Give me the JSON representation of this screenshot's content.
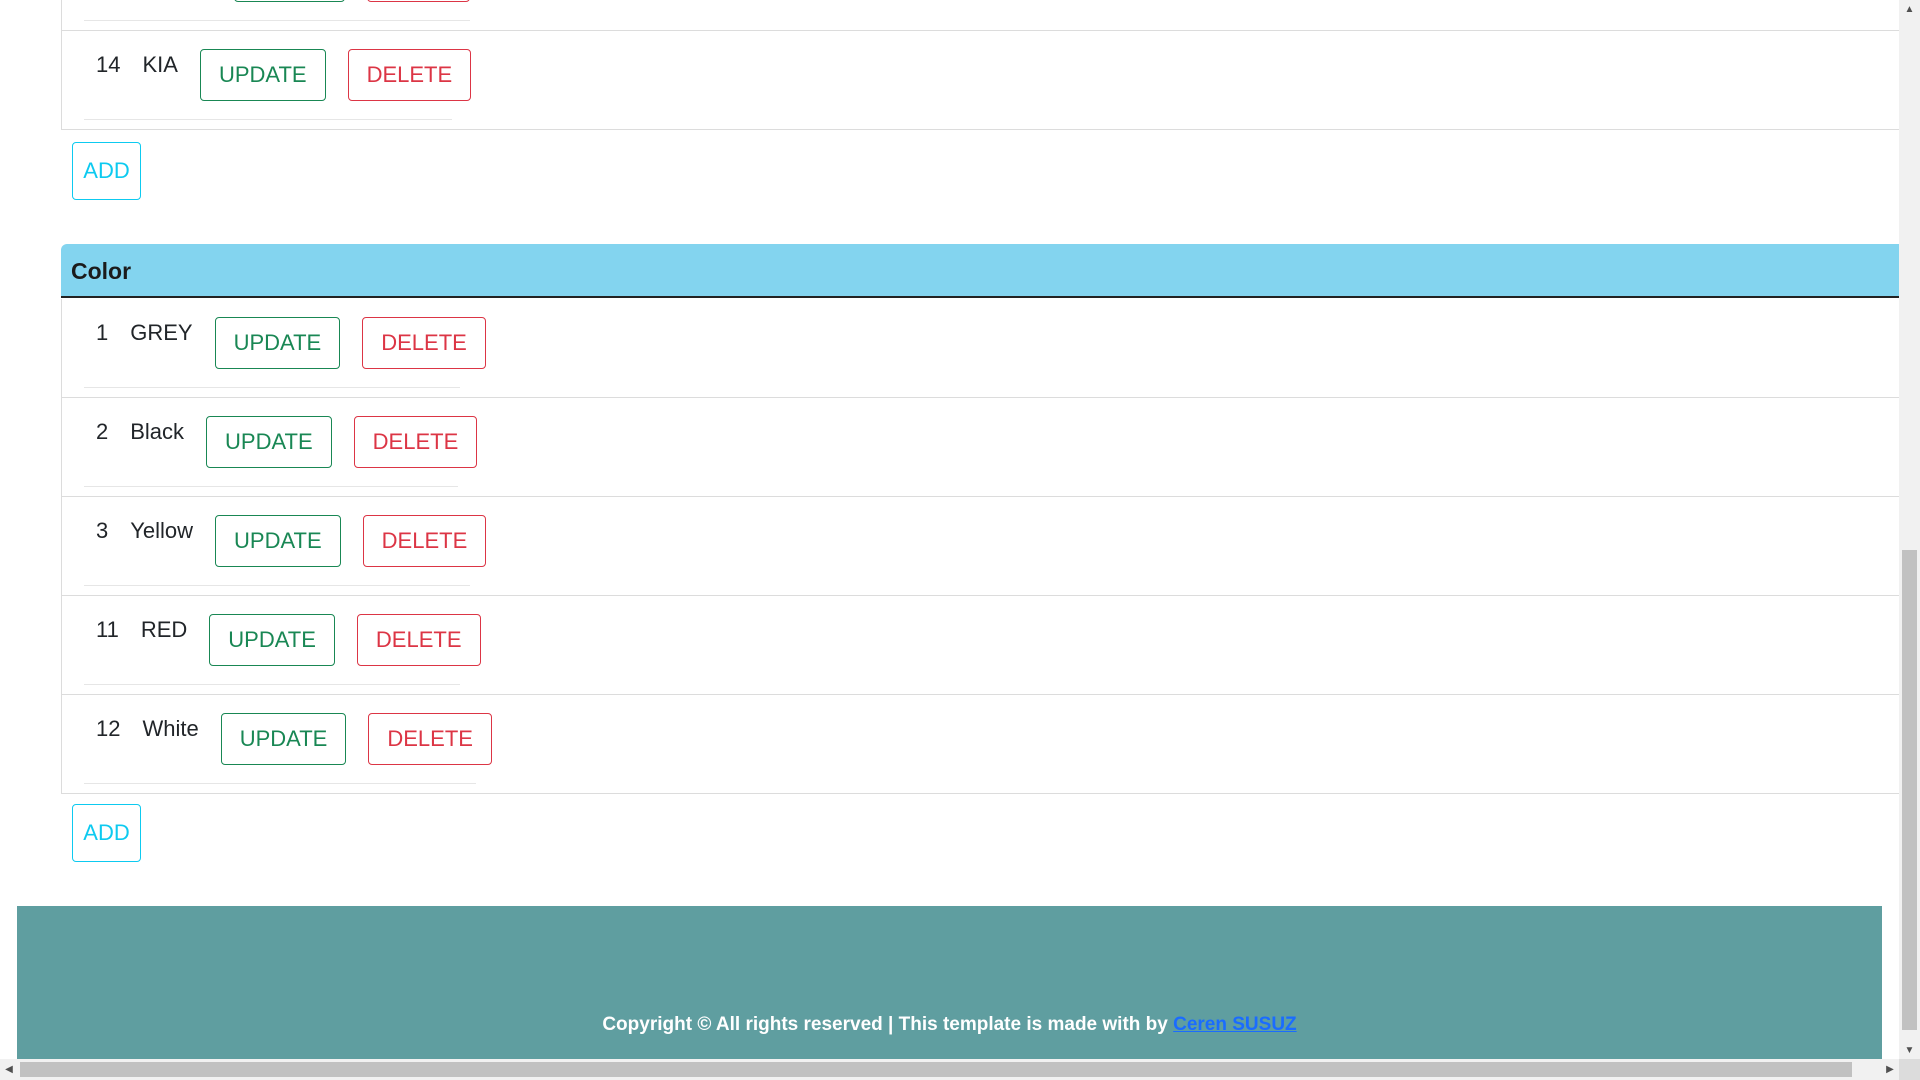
{
  "brand_section": {
    "rows": [
      {
        "id": "14",
        "name": "KIA",
        "update_label": "UPDATE",
        "delete_label": "DELETE"
      }
    ],
    "add_label": "ADD"
  },
  "color_section": {
    "title": "Color",
    "rows": [
      {
        "id": "1",
        "name": "GREY",
        "update_label": "UPDATE",
        "delete_label": "DELETE"
      },
      {
        "id": "2",
        "name": "Black",
        "update_label": "UPDATE",
        "delete_label": "DELETE"
      },
      {
        "id": "3",
        "name": "Yellow",
        "update_label": "UPDATE",
        "delete_label": "DELETE"
      },
      {
        "id": "11",
        "name": "RED",
        "update_label": "UPDATE",
        "delete_label": "DELETE"
      },
      {
        "id": "12",
        "name": "White",
        "update_label": "UPDATE",
        "delete_label": "DELETE"
      }
    ],
    "add_label": "ADD"
  },
  "footer": {
    "text": "Copyright © All rights reserved | This template is made with by ",
    "author_link": "Ceren SUSUZ"
  },
  "colors": {
    "header_bg": "#83d4ef",
    "footer_bg": "#5f9ea0",
    "update": "#198754",
    "delete": "#dc3545",
    "add": "#0dcaf0"
  }
}
